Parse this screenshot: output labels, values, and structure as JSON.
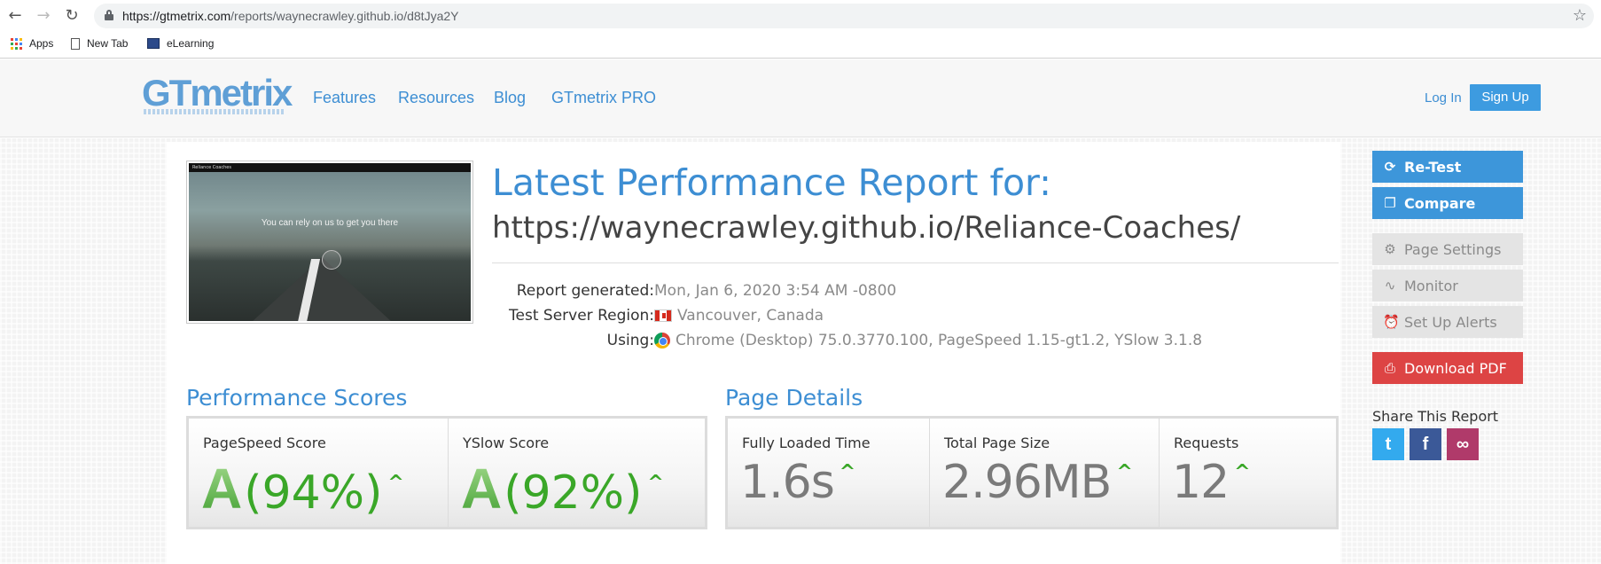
{
  "browser": {
    "url_domain": "https://gtmetrix.com",
    "url_path": "/reports/waynecrawley.github.io/d8tJya2Y",
    "bookmarks": [
      {
        "label": "Apps",
        "icon": "apps-grid-icon"
      },
      {
        "label": "New Tab",
        "icon": "page-icon"
      },
      {
        "label": "eLearning",
        "icon": "elearning-icon"
      }
    ]
  },
  "header": {
    "logo": "GTmetrix",
    "nav": [
      "Features",
      "Resources",
      "Blog",
      "GTmetrix PRO"
    ],
    "login": "Log In",
    "signup": "Sign Up"
  },
  "report": {
    "thumb_site_name": "Reliance Coaches",
    "thumb_tagline": "You can rely on us to get you there",
    "title": "Latest Performance Report for:",
    "url": "https://waynecrawley.github.io/Reliance-Coaches/",
    "meta": [
      {
        "label": "Report generated:",
        "value": "Mon, Jan 6, 2020 3:54 AM -0800",
        "icon": ""
      },
      {
        "label": "Test Server Region:",
        "value": "Vancouver, Canada",
        "icon": "canada-flag-icon"
      },
      {
        "label": "Using:",
        "value": "Chrome (Desktop) 75.0.3770.100, PageSpeed 1.15-gt1.2, YSlow 3.1.8",
        "icon": "chrome-icon"
      }
    ]
  },
  "performance": {
    "title": "Performance Scores",
    "scores": [
      {
        "label": "PageSpeed Score",
        "grade": "A",
        "percent": "(94%)"
      },
      {
        "label": "YSlow Score",
        "grade": "A",
        "percent": "(92%)"
      }
    ]
  },
  "details": {
    "title": "Page Details",
    "items": [
      {
        "label": "Fully Loaded Time",
        "value": "1.6s"
      },
      {
        "label": "Total Page Size",
        "value": "2.96MB"
      },
      {
        "label": "Requests",
        "value": "12"
      }
    ]
  },
  "sidebar": {
    "retest": "Re-Test",
    "compare": "Compare",
    "page_settings": "Page Settings",
    "monitor": "Monitor",
    "alerts": "Set Up Alerts",
    "download": "Download PDF",
    "share_title": "Share This Report"
  },
  "colors": {
    "accent": "#3d8ed3",
    "grade_green": "#3aa728",
    "pdf_red": "#dd4444",
    "twitter": "#33aaee",
    "facebook": "#3b5998",
    "link": "#b03a6a"
  }
}
